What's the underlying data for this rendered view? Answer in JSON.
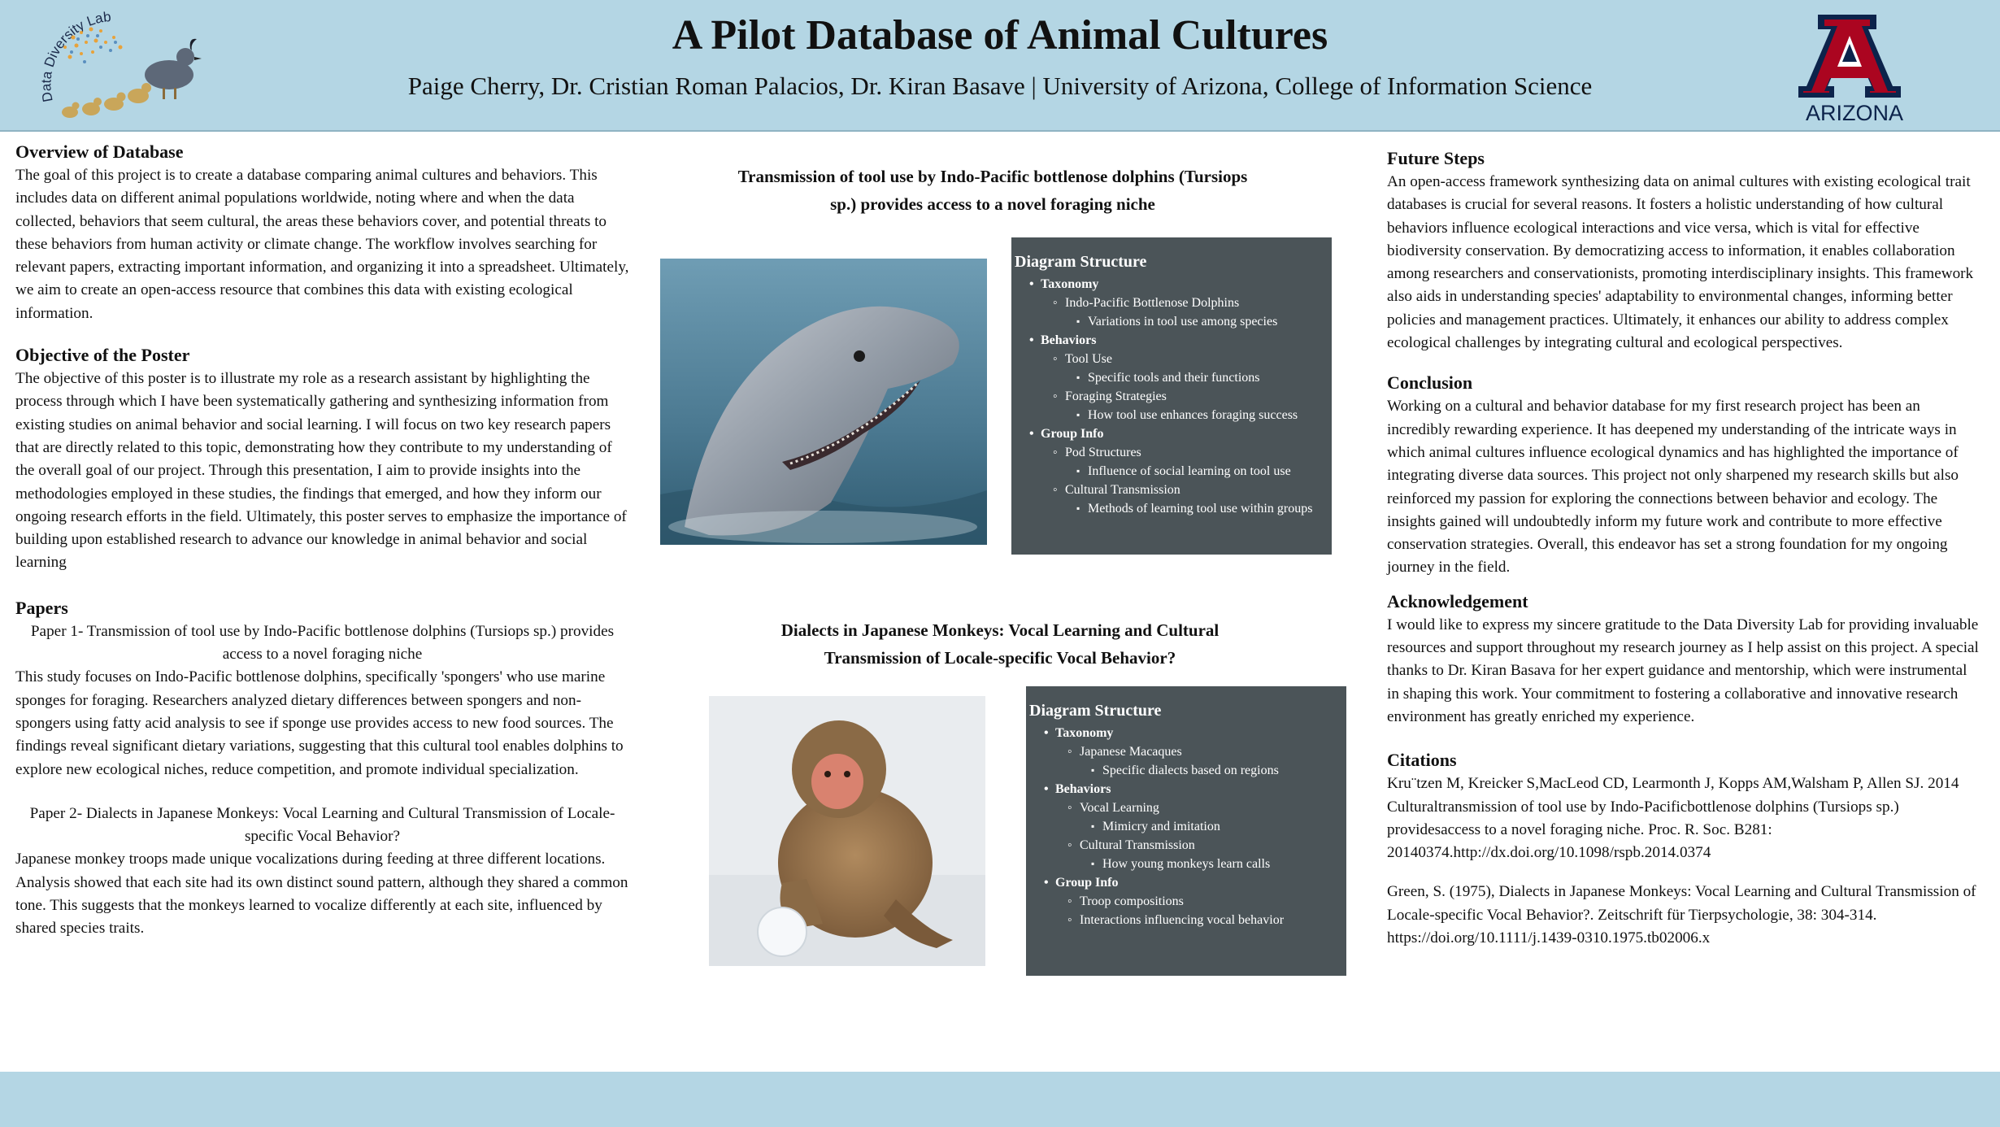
{
  "header": {
    "title": "A Pilot Database of Animal Cultures",
    "authors": "Paige Cherry, Dr. Cristian Roman Palacios, Dr. Kiran Basave | University of Arizona, College of Information Science",
    "left_logo_text": "Data Diversity Lab",
    "right_logo_text": "ARIZONA",
    "colors": {
      "header_bg": "#b4d6e4",
      "arizona_red": "#ab0520",
      "arizona_blue": "#0c234b",
      "diagram_bg": "#4b5458"
    }
  },
  "left": {
    "overview": {
      "heading": "Overview of Database",
      "body": "The goal of this project is to create a database comparing animal cultures and behaviors. This includes data on different animal populations worldwide, noting where and when the data collected, behaviors that seem cultural, the areas these behaviors cover, and potential threats to these behaviors from human activity or climate change. The workflow involves searching for relevant papers, extracting important information, and organizing it into a spreadsheet. Ultimately, we aim to create an open-access resource that combines this data with existing ecological information."
    },
    "objective": {
      "heading": "Objective of the Poster",
      "body": "The objective of this poster is to illustrate my role as a research assistant by highlighting the process through which I have been systematically gathering and synthesizing information from existing studies on animal behavior and social learning. I will focus on two key research papers that are directly related to this topic, demonstrating how they contribute to my understanding of the overall goal of our project. Through this presentation, I aim to provide insights into the methodologies employed in these studies, the findings that emerged, and how they inform our ongoing research efforts in the field. Ultimately, this poster serves to emphasize the importance of building upon established research to advance our knowledge in animal behavior and social learning"
    },
    "papers": {
      "heading": "Papers",
      "paper1_title": "Paper 1- Transmission of tool use by Indo-Pacific bottlenose dolphins (Tursiops sp.) provides access to a novel foraging niche",
      "paper1_body": "This study focuses on Indo-Pacific bottlenose dolphins, specifically 'spongers' who use marine sponges for foraging. Researchers analyzed dietary differences between spongers and non-spongers using fatty acid analysis to see if sponge use provides access to new food sources. The findings reveal significant dietary variations, suggesting that this cultural tool enables dolphins to explore new ecological niches, reduce competition, and promote individual specialization.",
      "paper2_title": "Paper 2- Dialects in Japanese Monkeys: Vocal Learning and Cultural Transmission of Locale-specific Vocal Behavior?",
      "paper2_body": "Japanese monkey troops made unique vocalizations during feeding at three different locations. Analysis showed that each site had its own distinct sound pattern, although they shared a common tone. This suggests that the monkeys learned to vocalize differently at each site, influenced by shared species traits."
    }
  },
  "middle": {
    "dolphin": {
      "title": "Transmission of tool use by Indo-Pacific bottlenose dolphins (Tursiops sp.) provides access to a novel foraging niche",
      "diagram": {
        "heading": "Diagram Structure",
        "items": [
          {
            "level": 1,
            "text": "Taxonomy"
          },
          {
            "level": 2,
            "text": "Indo-Pacific Bottlenose Dolphins"
          },
          {
            "level": 3,
            "text": "Variations in tool use among species"
          },
          {
            "level": 1,
            "text": "Behaviors"
          },
          {
            "level": 2,
            "text": "Tool Use"
          },
          {
            "level": 3,
            "text": "Specific tools and their functions"
          },
          {
            "level": 2,
            "text": "Foraging Strategies"
          },
          {
            "level": 3,
            "text": "How tool use enhances foraging success"
          },
          {
            "level": 1,
            "text": "Group Info"
          },
          {
            "level": 2,
            "text": "Pod Structures"
          },
          {
            "level": 3,
            "text": "Influence of social learning on tool use"
          },
          {
            "level": 2,
            "text": "Cultural Transmission"
          },
          {
            "level": 3,
            "text": "Methods of learning tool use within groups"
          }
        ]
      }
    },
    "monkey": {
      "title": "Dialects in Japanese Monkeys: Vocal Learning and Cultural Transmission of Locale-specific Vocal Behavior?",
      "diagram": {
        "heading": "Diagram Structure",
        "items": [
          {
            "level": 1,
            "text": "Taxonomy"
          },
          {
            "level": 2,
            "text": "Japanese Macaques"
          },
          {
            "level": 3,
            "text": "Specific dialects based on regions"
          },
          {
            "level": 1,
            "text": "Behaviors"
          },
          {
            "level": 2,
            "text": "Vocal Learning"
          },
          {
            "level": 3,
            "text": "Mimicry and imitation"
          },
          {
            "level": 2,
            "text": "Cultural Transmission"
          },
          {
            "level": 3,
            "text": "How young monkeys learn calls"
          },
          {
            "level": 1,
            "text": "Group Info"
          },
          {
            "level": 2,
            "text": "Troop compositions"
          },
          {
            "level": 2,
            "text": "Interactions influencing vocal behavior"
          }
        ]
      }
    }
  },
  "right": {
    "future": {
      "heading": "Future Steps",
      "body": "An open-access framework synthesizing data on animal cultures with existing ecological trait databases is crucial for several reasons. It fosters a holistic understanding of how cultural behaviors influence ecological interactions and vice versa, which is vital for effective biodiversity conservation. By democratizing access to information, it enables collaboration among researchers and conservationists, promoting interdisciplinary insights. This framework also aids in understanding species' adaptability to environmental changes, informing better policies and management practices. Ultimately, it enhances our ability to address complex ecological challenges by integrating cultural and ecological perspectives."
    },
    "conclusion": {
      "heading": "Conclusion",
      "body": "Working on a cultural and behavior database for my first research project has been an incredibly rewarding experience. It has deepened my understanding of the intricate ways in which animal cultures influence ecological dynamics and has highlighted the importance of integrating diverse data sources. This project not only sharpened my research skills but also reinforced my passion for exploring the connections between behavior and ecology. The insights gained will undoubtedly inform my future work and contribute to more effective conservation strategies. Overall, this endeavor has set a strong foundation for my ongoing journey in the field."
    },
    "acknowledgement": {
      "heading": "Acknowledgement",
      "body": "I would like to express my sincere gratitude to the Data Diversity Lab for providing invaluable resources and support throughout my research journey as I help assist on this project. A special thanks to Dr. Kiran Basava for her expert guidance and mentorship, which were instrumental in shaping this work. Your commitment to fostering a collaborative and innovative research environment has greatly enriched my experience."
    },
    "citations": {
      "heading": "Citations",
      "cite1": "Kru¨tzen M, Kreicker S,MacLeod CD, Learmonth J, Kopps AM,Walsham P, Allen SJ. 2014 Culturaltransmission of tool use by Indo-Pacificbottlenose dolphins (Tursiops sp.) providesaccess to a novel foraging niche. Proc. R. Soc. B281: 20140374.http://dx.doi.org/10.1098/rspb.2014.0374",
      "cite2": "Green, S. (1975), Dialects in Japanese Monkeys: Vocal Learning and Cultural Transmission of Locale-specific Vocal Behavior?. Zeitschrift für Tierpsychologie, 38: 304-314. https://doi.org/10.1111/j.1439-0310.1975.tb02006.x"
    }
  }
}
